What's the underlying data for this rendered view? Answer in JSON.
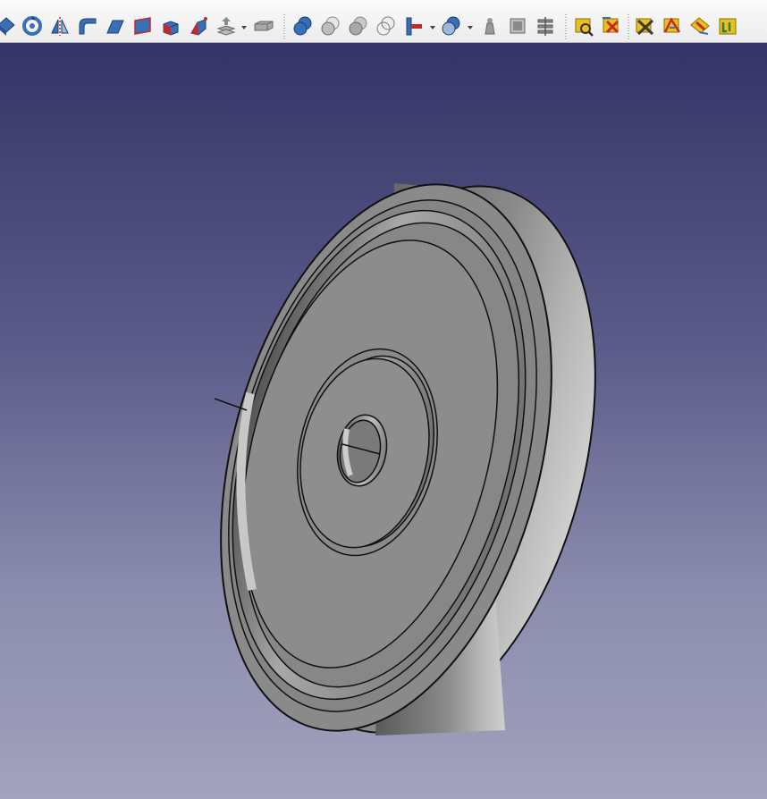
{
  "colors": {
    "toolbar_bg": "#f0f0f0",
    "viewport_top": "#333366",
    "viewport_bottom": "#a2a2be",
    "icon_blue": "#3a6fb5",
    "icon_red": "#c62828",
    "icon_yellow": "#e8c020",
    "part_gray": "#8a8a8a",
    "edge_black": "#111111"
  },
  "toolbar": {
    "part_tools": [
      "revolve-icon",
      "groove-icon",
      "mirror-icon",
      "fillet-icon",
      "chamfer-icon",
      "face-icon",
      "box-icon",
      "wedge-icon",
      "extrude-icon",
      "solid-box-icon"
    ],
    "boolean_tools": [
      "union-icon",
      "cut-icon",
      "common-icon",
      "section-icon",
      "join-icon",
      "split-icon",
      "measure-icon",
      "view-icon",
      "compound-icon"
    ],
    "measure_tools": [
      "measure-linear-icon",
      "measure-angular-icon",
      "measure-refresh-icon",
      "toggle-all-icon",
      "toggle-3d-icon",
      "toggle-delta-icon"
    ]
  }
}
